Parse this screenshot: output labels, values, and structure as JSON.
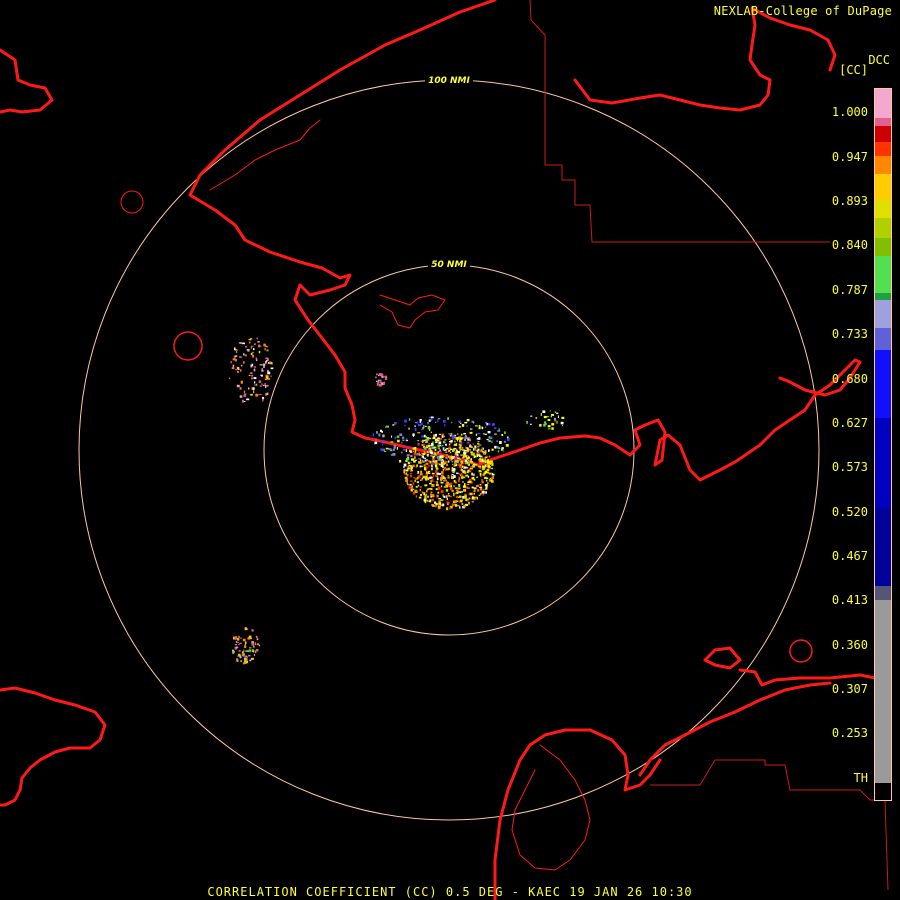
{
  "credit": "NEXLAB-College of DuPage",
  "colorbar": {
    "product_code": "DCC",
    "units": "[CC]",
    "ticks": [
      "1.000",
      "0.947",
      "0.893",
      "0.840",
      "0.787",
      "0.733",
      "0.680",
      "0.627",
      "0.573",
      "0.520",
      "0.467",
      "0.413",
      "0.360",
      "0.307",
      "0.253",
      "TH"
    ]
  },
  "range_rings": [
    "100 NMI",
    "50 NMI"
  ],
  "caption": "CORRELATION COEFFICIENT (CC) 0.5 DEG - KAEC 19 JAN 26 10:30",
  "colors": {
    "background": "#000000",
    "coastline": "#ff1a1a",
    "boundary": "#cc1a1a",
    "range_ring": "#ffc8a0",
    "text": "#ffff33"
  }
}
